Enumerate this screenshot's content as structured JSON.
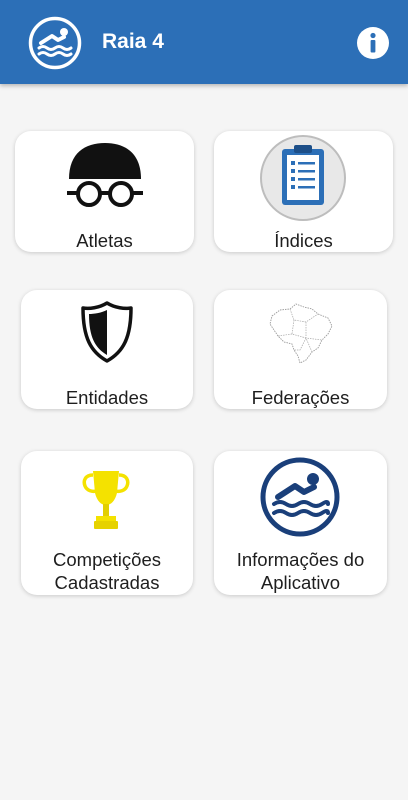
{
  "appbar": {
    "title": "Raia 4",
    "logo_icon": "swimmer-icon",
    "info_icon": "info-icon",
    "color": "#2c6fb7"
  },
  "menu": {
    "atletas": {
      "label": "Atletas",
      "icon": "swim-cap-goggles-icon"
    },
    "indices": {
      "label": "Índices",
      "icon": "clipboard-icon"
    },
    "entidades": {
      "label": "Entidades",
      "icon": "shield-icon"
    },
    "federacoes": {
      "label": "Federações",
      "icon": "brazil-map-icon"
    },
    "competicoes": {
      "label_line1": "Competições",
      "label_line2": "Cadastradas",
      "icon": "trophy-icon"
    },
    "informacoes": {
      "label_line1": "Informações do",
      "label_line2": "Aplicativo",
      "icon": "swimmer-icon"
    }
  }
}
